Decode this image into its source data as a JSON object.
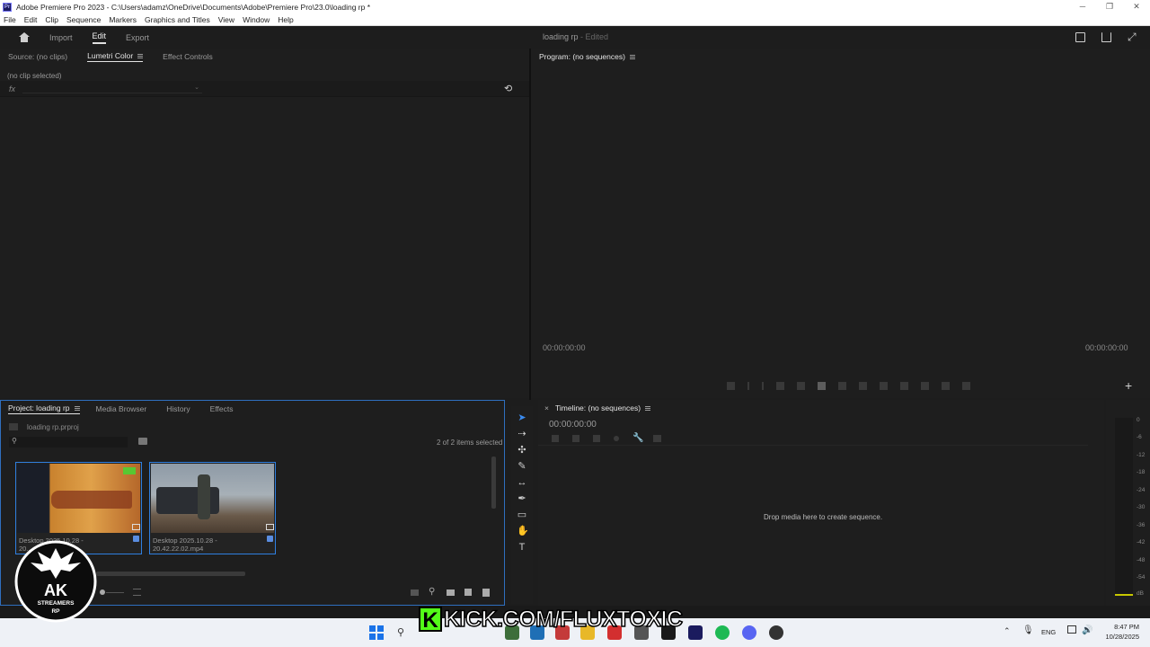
{
  "window": {
    "title": "Adobe Premiere Pro 2023 - C:\\Users\\adamz\\OneDrive\\Documents\\Adobe\\Premiere Pro\\23.0\\loading rp *",
    "controls": [
      "─",
      "❐",
      "✕"
    ]
  },
  "menu": [
    "File",
    "Edit",
    "Clip",
    "Sequence",
    "Markers",
    "Graphics and Titles",
    "View",
    "Window",
    "Help"
  ],
  "header": {
    "nav": [
      "Import",
      "Edit",
      "Export"
    ],
    "active": "Edit",
    "project_name": "loading rp",
    "status": "Edited"
  },
  "source_panel": {
    "tabs": [
      "Source: (no clips)",
      "Lumetri Color",
      "Effect Controls"
    ],
    "active_tab": "Lumetri Color",
    "no_clip_text": "(no clip selected)",
    "fx_label": "fx"
  },
  "program_panel": {
    "title": "Program: (no sequences)",
    "timecode_left": "00:00:00:00",
    "timecode_right": "00:00:00:00"
  },
  "project_panel": {
    "tabs": [
      "Project: loading rp",
      "Media Browser",
      "History",
      "Effects"
    ],
    "active_tab": "Project: loading rp",
    "project_file": "loading rp.prproj",
    "selection_info": "2 of 2 items selected",
    "items": [
      {
        "name_line1": "Desktop 2025.10.28 -",
        "name_line2": "20..."
      },
      {
        "name_line1": "Desktop 2025.10.28 -",
        "name_line2": "20.42.22.02.mp4"
      }
    ]
  },
  "timeline_panel": {
    "title": "Timeline: (no sequences)",
    "timecode": "00:00:00:00",
    "empty_text": "Drop media here to create sequence."
  },
  "audio_meter": {
    "labels": [
      "0",
      "-6",
      "-12",
      "-18",
      "-24",
      "-30",
      "-36",
      "-42",
      "-48",
      "-54",
      "dB"
    ]
  },
  "overlay": {
    "kick_letter": "K",
    "kick_text": "KICK.COM/FLUXTOXIC",
    "logo_line1": "AK",
    "logo_line2": "STREAMERS",
    "logo_line3": "RP"
  },
  "taskbar": {
    "language": "ENG",
    "time": "8:47 PM",
    "date": "10/28/2025"
  },
  "colors": {
    "accent_blue": "#2f7fe0",
    "kick_green": "#53fc18"
  }
}
